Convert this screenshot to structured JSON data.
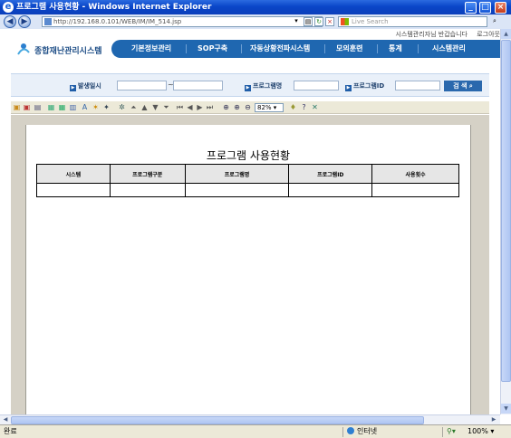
{
  "window": {
    "title": "프로그램 사용현황 - Windows Internet Explorer"
  },
  "browser": {
    "address": "http://192.168.0.101/WEB/IM/IM_514.jsp",
    "search_placeholder": "Live Search"
  },
  "site": {
    "logo_text": "종합재난관리시스템",
    "top_links": [
      "시스템관리자님 반갑습니다",
      "로그아웃"
    ],
    "menu": [
      "기본정보관리",
      "SOP구축",
      "자동상황전파시스템",
      "모의훈련",
      "통계",
      "시스템관리"
    ]
  },
  "filters": {
    "occurrence_label": "발생일시",
    "range_separator": "~",
    "program_name_label": "프로그램명",
    "program_id_label": "프로그램ID",
    "search_button": "검 색"
  },
  "report_toolbar": {
    "zoom": "82%"
  },
  "report": {
    "title": "프로그램 사용현황",
    "columns": [
      "시스템",
      "프로그램구분",
      "프로그램명",
      "프로그램ID",
      "사용횟수"
    ]
  },
  "statusbar": {
    "status": "완료",
    "zone": "인터넷",
    "zoom": "100%"
  },
  "colors": {
    "menu_bg": "#1f67b0",
    "filter_bg": "#e9f0f9",
    "viewer_bg": "#d5d1c6"
  }
}
